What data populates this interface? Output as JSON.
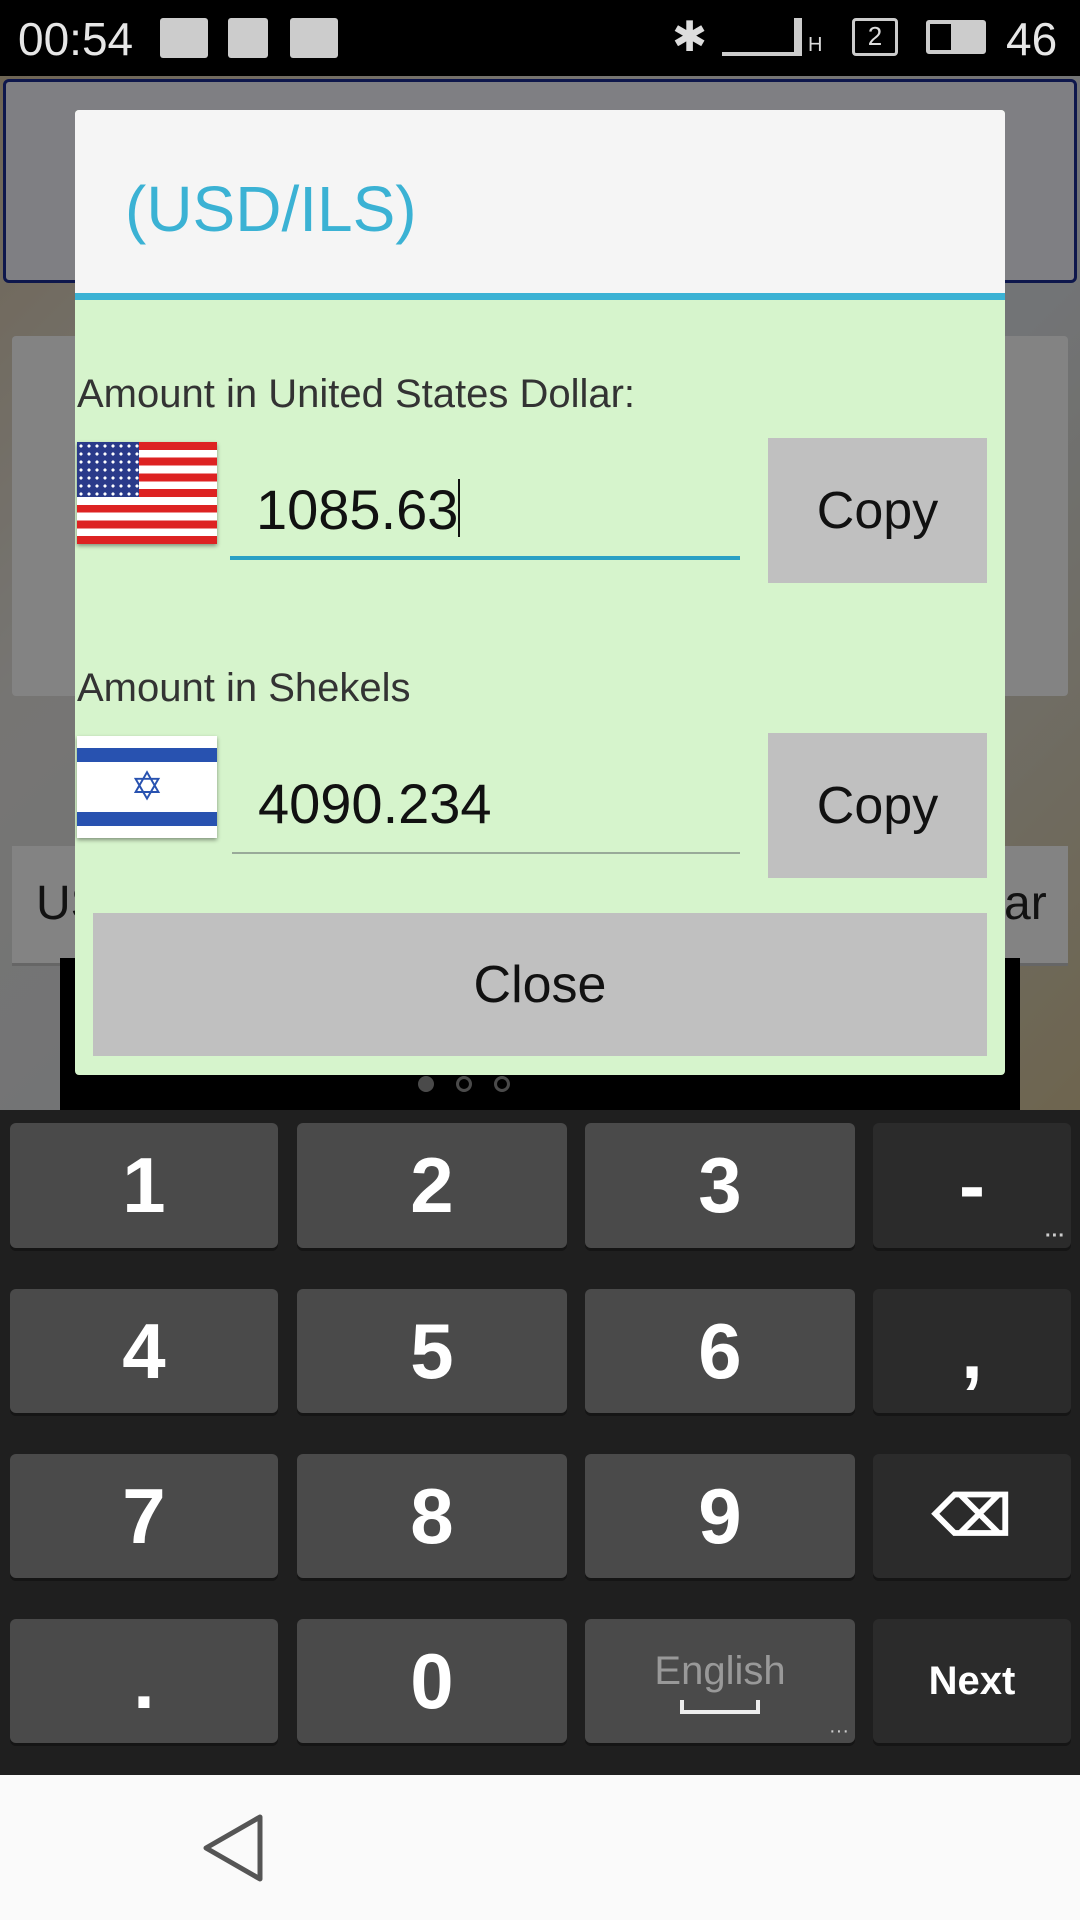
{
  "status_bar": {
    "time": "00:54",
    "icons": [
      "image-icon",
      "gmail-icon",
      "keyboard-icon",
      "bluetooth-icon",
      "signal-icon",
      "sim-2-icon",
      "battery-icon"
    ],
    "sim": "2",
    "battery": "46",
    "network": "H"
  },
  "background": {
    "fragment_left": "US",
    "fragment_right": "ar"
  },
  "dialog": {
    "title": "(USD/ILS)",
    "usd_label": "Amount in United States Dollar:",
    "usd_value": "1085.63",
    "ils_label": "Amount in Shekels",
    "ils_value": "4090.234",
    "copy_label": "Copy",
    "close_label": "Close",
    "accent": "#3bb2d4",
    "body_color": "#d6f4cc"
  },
  "keyboard": {
    "rows": [
      [
        "1",
        "2",
        "3",
        "-"
      ],
      [
        "4",
        "5",
        "6",
        ","
      ],
      [
        "7",
        "8",
        "9",
        "⌫"
      ],
      [
        ".",
        "0",
        "English",
        "Next"
      ]
    ]
  }
}
